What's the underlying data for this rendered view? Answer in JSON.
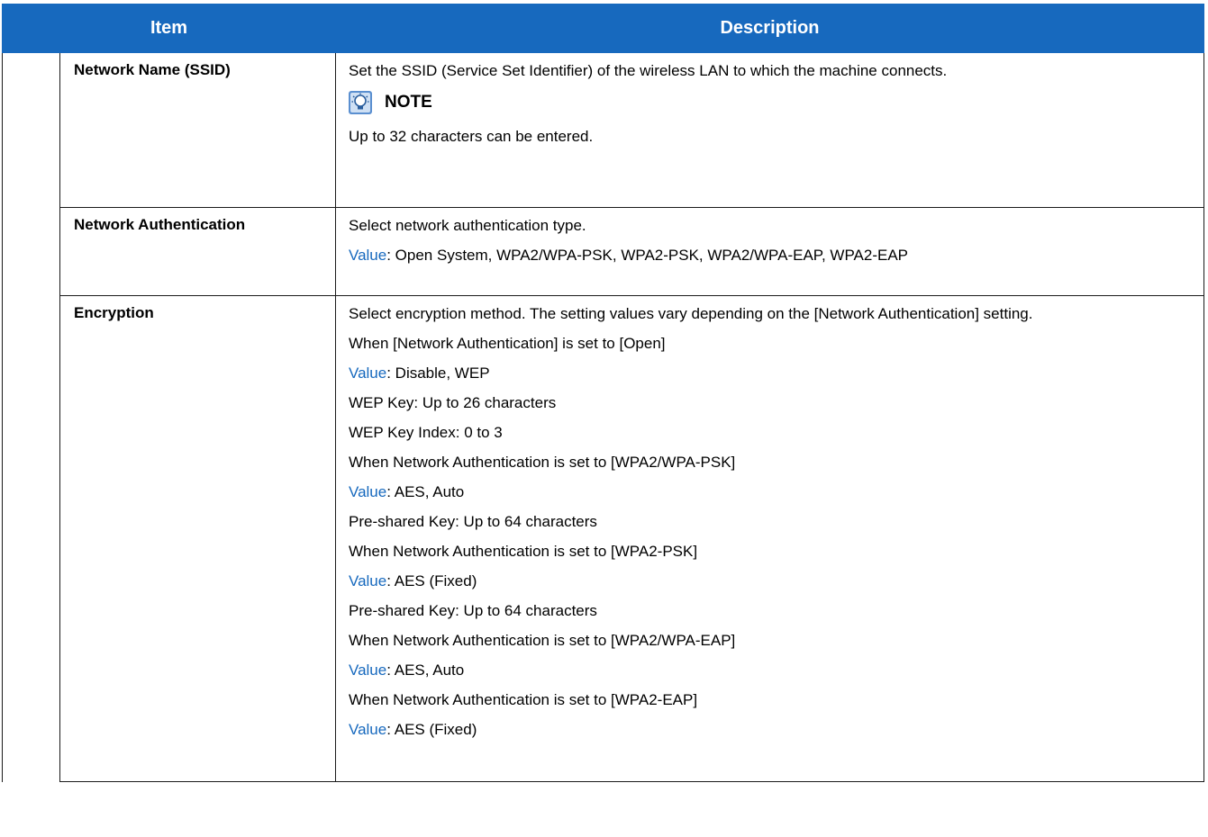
{
  "table": {
    "headers": {
      "item": "Item",
      "description": "Description"
    },
    "rows": [
      {
        "item": "Network Name (SSID)",
        "lines": [
          "Set the SSID (Service Set Identifier) of the wireless LAN to which the machine connects."
        ],
        "note": {
          "icon": "note-bulb-icon",
          "title": "NOTE",
          "text": "Up to 32 characters can be entered."
        }
      },
      {
        "item": "Network Authentication",
        "lines": [
          "Select network authentication type."
        ],
        "value": {
          "label": "Value",
          "text": ": Open System, WPA2/WPA-PSK, WPA2-PSK, WPA2/WPA-EAP, WPA2-EAP"
        }
      },
      {
        "item": "Encryption",
        "lines": [
          {
            "text": "Select encryption method. The setting values vary depending on the [Network Authentication] setting."
          },
          {
            "text": "When [Network Authentication] is set to [Open]"
          },
          {
            "label": "Value",
            "text": ": Disable, WEP"
          },
          {
            "text": "WEP Key: Up to 26 characters"
          },
          {
            "text": "WEP Key Index: 0 to 3"
          },
          {
            "text": "When Network Authentication is set to [WPA2/WPA-PSK]"
          },
          {
            "label": "Value",
            "text": ": AES, Auto"
          },
          {
            "text": "Pre-shared Key: Up to 64 characters"
          },
          {
            "text": "When Network Authentication is set to [WPA2-PSK]"
          },
          {
            "label": "Value",
            "text": ": AES (Fixed)"
          },
          {
            "text": "Pre-shared Key: Up to 64 characters"
          },
          {
            "text": "When Network Authentication is set to [WPA2/WPA-EAP]"
          },
          {
            "label": "Value",
            "text": ": AES, Auto"
          },
          {
            "text": "When Network Authentication is set to [WPA2-EAP]"
          },
          {
            "label": "Value",
            "text": ": AES (Fixed)"
          }
        ]
      }
    ]
  },
  "colors": {
    "header_bg": "#1769be",
    "value_label": "#1769be",
    "border": "#1a1a1a"
  }
}
